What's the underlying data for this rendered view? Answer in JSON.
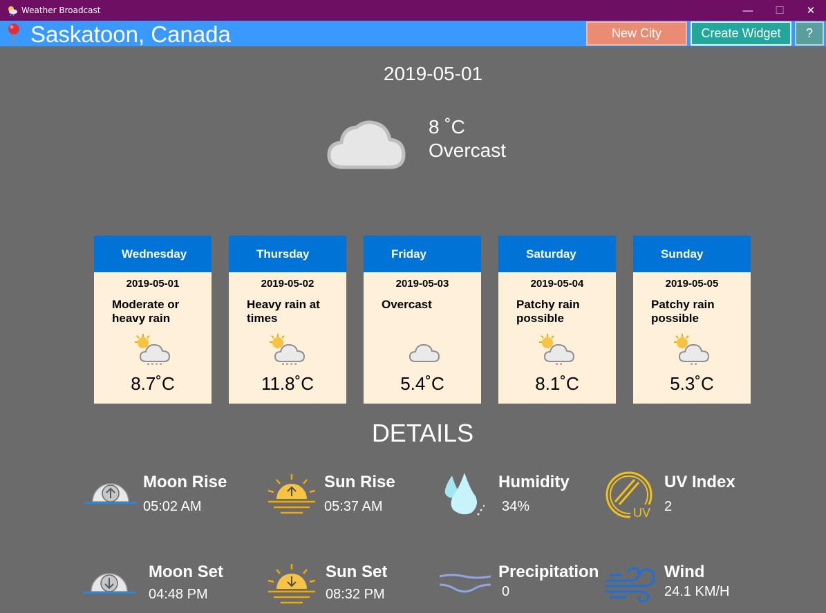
{
  "window": {
    "title": "Weather Broadcast"
  },
  "header": {
    "city": "Saskatoon, Canada",
    "new_city_label": "New City",
    "create_widget_label": "Create Widget",
    "help_label": "?"
  },
  "current": {
    "date": "2019-05-01",
    "temperature": "8 ˚C",
    "condition": "Overcast",
    "icon": "cloud-icon"
  },
  "forecast": [
    {
      "day": "Wednesday",
      "date": "2019-05-01",
      "condition": "Moderate or heavy rain",
      "temp": "8.7˚C",
      "icon": "sun-cloud-rain-icon"
    },
    {
      "day": "Thursday",
      "date": "2019-05-02",
      "condition": "Heavy rain at times",
      "temp": "11.8˚C",
      "icon": "sun-cloud-rain-icon"
    },
    {
      "day": "Friday",
      "date": "2019-05-03",
      "condition": "Overcast",
      "temp": "5.4˚C",
      "icon": "cloud-icon"
    },
    {
      "day": "Saturday",
      "date": "2019-05-04",
      "condition": "Patchy rain possible",
      "temp": "8.1˚C",
      "icon": "sun-cloud-drizzle-icon"
    },
    {
      "day": "Sunday",
      "date": "2019-05-05",
      "condition": "Patchy rain possible",
      "temp": "5.3˚C",
      "icon": "sun-cloud-drizzle-icon"
    }
  ],
  "details": {
    "title": "DETAILS",
    "moon_rise": {
      "label": "Moon Rise",
      "value": "05:02 AM"
    },
    "sun_rise": {
      "label": "Sun Rise",
      "value": "05:37 AM"
    },
    "humidity": {
      "label": "Humidity",
      "value": "34%"
    },
    "uv_index": {
      "label": "UV Index",
      "value": "2",
      "icon_text": "UV"
    },
    "moon_set": {
      "label": "Moon Set",
      "value": "04:48 PM"
    },
    "sun_set": {
      "label": "Sun Set",
      "value": "08:32 PM"
    },
    "precipitation": {
      "label": "Precipitation",
      "value": "0"
    },
    "wind": {
      "label": "Wind",
      "value": "24.1 KM/H"
    }
  },
  "colors": {
    "titlebar": "#6e0f63",
    "city_bar": "#3a99fe",
    "background": "#6b6b6b",
    "card_header": "#0074d6",
    "card_body": "#fff0d9",
    "new_city_button": "#ea8c74",
    "create_widget_button": "#22a79c",
    "help_button": "#5a9ea0"
  }
}
